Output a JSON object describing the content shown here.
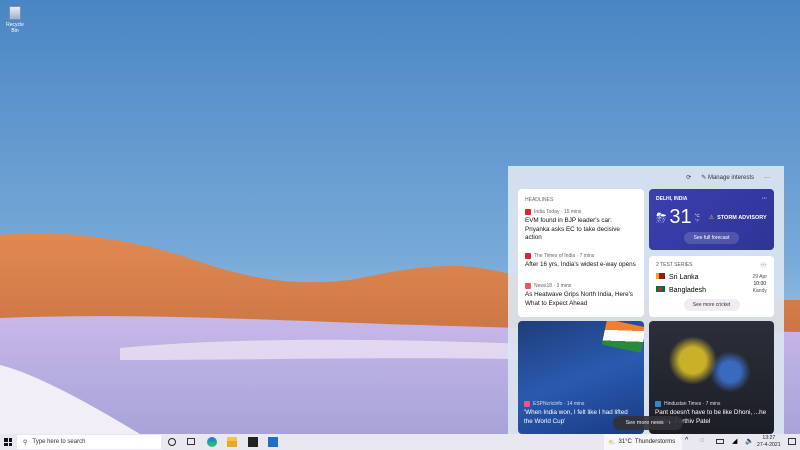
{
  "desktop": {
    "recycle_bin": "Recycle Bin"
  },
  "panel": {
    "manage_interests": "Manage interests",
    "more": "···",
    "headlines": {
      "title": "HEADLINES",
      "items": [
        {
          "source": "India Today · 15 mins",
          "title": "EVM found in BJP leader's car: Priyanka asks EC to take decisive action"
        },
        {
          "source": "The Times of India · 7 mins",
          "title": "After 16 yrs, India's widest e-way opens"
        },
        {
          "source": "News18 · 3 mins",
          "title": "As Heatwave Grips North India, Here's What to Expect Ahead"
        }
      ]
    },
    "weather": {
      "location": "DELHI, INDIA",
      "temp": "31",
      "unit_c": "°C",
      "unit_f": "°F",
      "advisory": "STORM ADVISORY",
      "forecast_button": "See full forecast",
      "more": "···"
    },
    "cricket": {
      "title": "2 TEST SERIES",
      "team1": "Sri Lanka",
      "team2": "Bangladesh",
      "date": "29 Apr",
      "time": "10:00",
      "venue": "Kandy",
      "button": "See more cricket",
      "more": "···"
    },
    "stories": [
      {
        "source": "ESPNcricinfo · 14 mins",
        "title": "'When India won, I felt like I had lifted the World Cup'"
      },
      {
        "source": "Hindustan Times · 7 mins",
        "title": "Pant doesn't have to be like Dhoni, ...he better: Parthiv Patel"
      }
    ],
    "see_more_news": "See more news"
  },
  "taskbar": {
    "search_placeholder": "Type here to search",
    "weather_temp": "31°C",
    "weather_text": "Thunderstorms",
    "time": "13:27",
    "date": "27-4-2021"
  }
}
